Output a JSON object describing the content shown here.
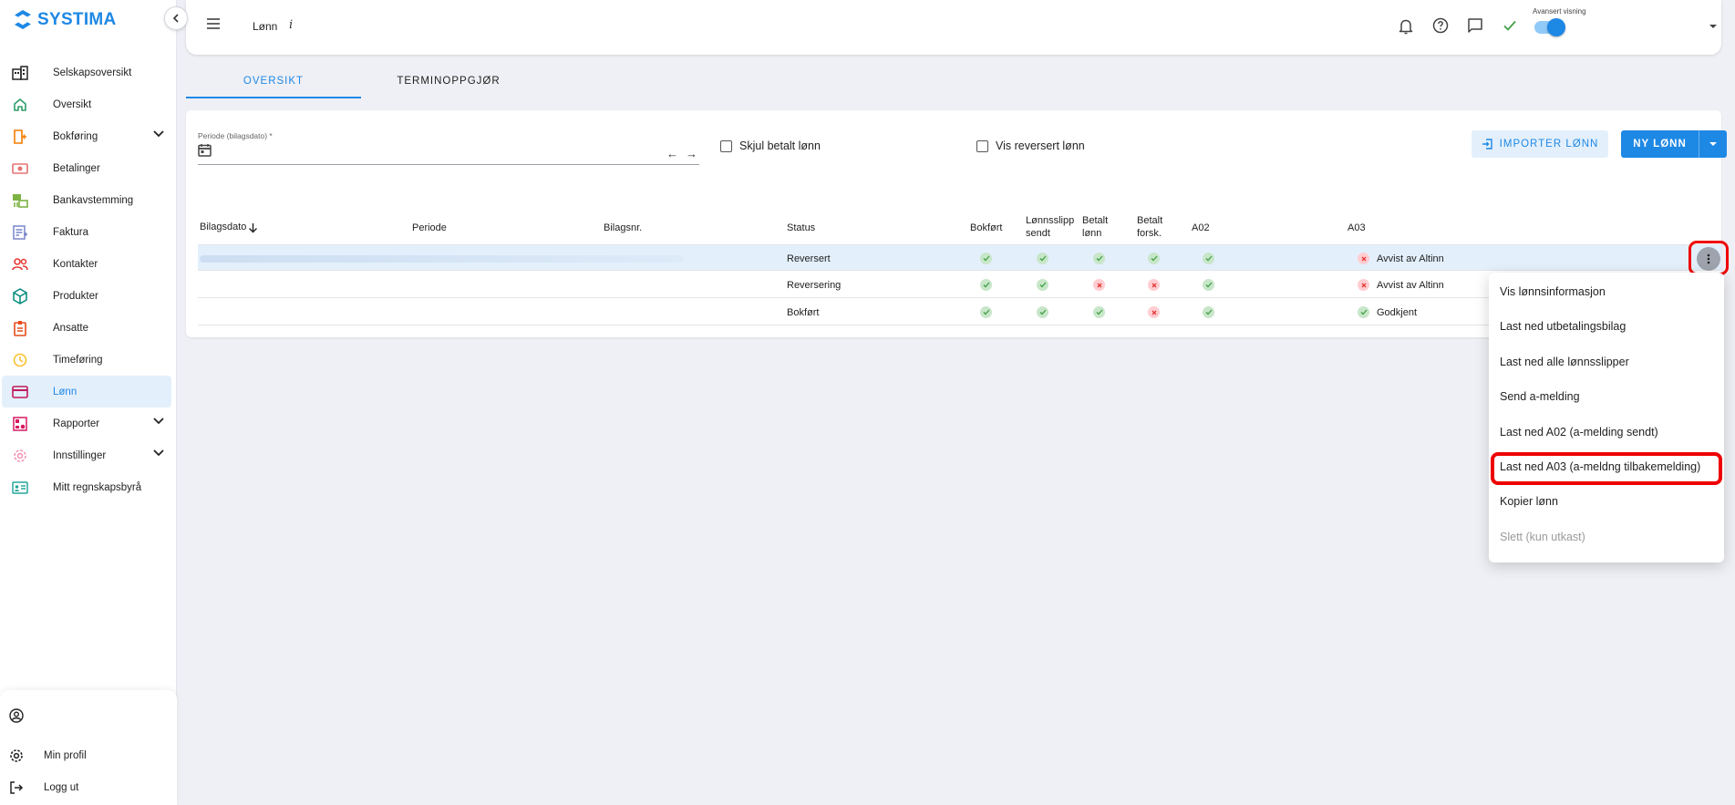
{
  "brand": {
    "name": "SYSTIMA"
  },
  "sidebar": {
    "items": [
      {
        "label": "Selskapsoversikt",
        "icon": "building-icon",
        "color": "#222222"
      },
      {
        "label": "Oversikt",
        "icon": "home-icon",
        "color": "#2e9d6b"
      },
      {
        "label": "Bokføring",
        "icon": "ledger-icon",
        "color": "#f57c00",
        "expandable": true
      },
      {
        "label": "Betalinger",
        "icon": "money-icon",
        "color": "#e57373"
      },
      {
        "label": "Bankavstemming",
        "icon": "bank-icon",
        "color": "#7cb342"
      },
      {
        "label": "Faktura",
        "icon": "invoice-icon",
        "color": "#7986cb"
      },
      {
        "label": "Kontakter",
        "icon": "contacts-icon",
        "color": "#e53935"
      },
      {
        "label": "Produkter",
        "icon": "cube-icon",
        "color": "#00897b"
      },
      {
        "label": "Ansatte",
        "icon": "badge-icon",
        "color": "#e64a19"
      },
      {
        "label": "Timeføring",
        "icon": "clock-icon",
        "color": "#fbc02d"
      },
      {
        "label": "Lønn",
        "icon": "card-icon",
        "color": "#c2185b",
        "active": true
      },
      {
        "label": "Rapporter",
        "icon": "report-icon",
        "color": "#d81b60",
        "expandable": true
      },
      {
        "label": "Innstillinger",
        "icon": "settings-icon",
        "color": "#f48fb1",
        "expandable": true
      },
      {
        "label": "Mitt regnskapsbyrå",
        "icon": "idcard-icon",
        "color": "#26a69a"
      }
    ],
    "bottom": {
      "user_label": "",
      "profile_label": "Min profil",
      "logout_label": "Logg ut"
    }
  },
  "header": {
    "title": "Lønn",
    "info_glyph": "i",
    "toggle_label": "Avansert visning",
    "toggle_on": true,
    "icons": [
      "bell-icon",
      "help-icon",
      "chat-icon",
      "check-icon"
    ]
  },
  "tabs": [
    {
      "label": "OVERSIKT",
      "active": true
    },
    {
      "label": "TERMINOPPGJØR",
      "active": false
    }
  ],
  "filters": {
    "period_label": "Periode (bilagsdato) *",
    "period_value": "",
    "prev_arrow": "←",
    "next_arrow": "→",
    "hide_paid_label": "Skjul betalt lønn",
    "show_reversed_label": "Vis reversert lønn"
  },
  "actions": {
    "import_label": "IMPORTER LØNN",
    "new_label": "NY LØNN"
  },
  "table": {
    "headers": {
      "bilagsdato": "Bilagsdato",
      "periode": "Periode",
      "bilagsnr": "Bilagsnr.",
      "status": "Status",
      "bokfort": "Bokført",
      "lonnsslipp_1": "Lønnsslipp",
      "lonnsslipp_2": "sendt",
      "betalt_lonn_1": "Betalt",
      "betalt_lonn_2": "lønn",
      "betalt_forsk_1": "Betalt",
      "betalt_forsk_2": "forsk.",
      "a02": "A02",
      "a03": "A03"
    },
    "sort_column": "Bilagsdato",
    "rows": [
      {
        "status": "Reversert",
        "bokfort": "ok",
        "lonnsslipp": "ok",
        "betalt_lonn": "ok",
        "betalt_forsk": "ok",
        "a02": "ok",
        "a03_state": "err",
        "a03_text": "Avvist av Altinn",
        "selected": true
      },
      {
        "status": "Reversering",
        "bokfort": "ok",
        "lonnsslipp": "ok",
        "betalt_lonn": "err",
        "betalt_forsk": "err",
        "a02": "ok",
        "a03_state": "err",
        "a03_text": "Avvist av Altinn",
        "selected": false
      },
      {
        "status": "Bokført",
        "bokfort": "ok",
        "lonnsslipp": "ok",
        "betalt_lonn": "ok",
        "betalt_forsk": "err",
        "a02": "ok",
        "a03_state": "ok",
        "a03_text": "Godkjent",
        "selected": false
      }
    ]
  },
  "context_menu": {
    "items": [
      {
        "label": "Vis lønnsinformasjon",
        "enabled": true
      },
      {
        "label": "Last ned utbetalingsbilag",
        "enabled": true
      },
      {
        "label": "Last ned alle lønnsslipper",
        "enabled": true
      },
      {
        "label": "Send a-melding",
        "enabled": true
      },
      {
        "label": "Last ned A02 (a-melding sendt)",
        "enabled": true
      },
      {
        "label": "Last ned A03 (a-meldng tilbakemelding)",
        "enabled": true,
        "highlighted": true
      },
      {
        "label": "Kopier lønn",
        "enabled": true
      },
      {
        "label": "Slett (kun utkast)",
        "enabled": false
      }
    ]
  },
  "colors": {
    "accent": "#1e88e5",
    "ok": "#43a047",
    "error": "#e53935",
    "highlight": "#ee0000"
  }
}
